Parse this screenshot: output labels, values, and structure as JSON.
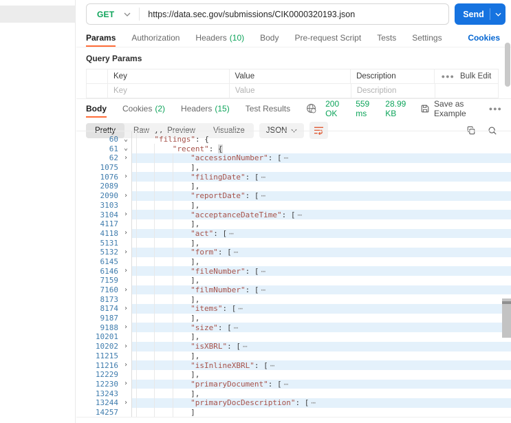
{
  "request": {
    "method": "GET",
    "url": "https://data.sec.gov/submissions/CIK0000320193.json",
    "send_label": "Send"
  },
  "request_tabs": [
    {
      "label": "Params",
      "active": true
    },
    {
      "label": "Authorization"
    },
    {
      "label": "Headers",
      "count": "(10)"
    },
    {
      "label": "Body"
    },
    {
      "label": "Pre-request Script"
    },
    {
      "label": "Tests"
    },
    {
      "label": "Settings"
    }
  ],
  "cookies_link": "Cookies",
  "query_params": {
    "title": "Query Params",
    "columns": {
      "key": "Key",
      "value": "Value",
      "description": "Description"
    },
    "bulk_edit": "Bulk Edit",
    "placeholders": {
      "key": "Key",
      "value": "Value",
      "description": "Description"
    }
  },
  "response": {
    "tabs": [
      {
        "label": "Body",
        "active": true
      },
      {
        "label": "Cookies",
        "count": "(2)"
      },
      {
        "label": "Headers",
        "count": "(15)"
      },
      {
        "label": "Test Results"
      }
    ],
    "status": "200 OK",
    "time": "559 ms",
    "size": "28.99 KB",
    "save_as_example": "Save as Example",
    "view_tabs": [
      {
        "label": "Pretty",
        "active": true
      },
      {
        "label": "Raw"
      },
      {
        "label": "Preview"
      },
      {
        "label": "Visualize"
      }
    ],
    "format": "JSON"
  },
  "colors": {
    "accent_orange": "#ff6c37",
    "method_green": "#0da45a",
    "link_blue": "#0265d2",
    "send_blue": "#1673e0",
    "key_red": "#a6524a",
    "line_number_blue": "#3f7cad",
    "fold_highlight": "#e4f1fb"
  },
  "code": {
    "fold_ellipsis": "⋯",
    "partial_top_line": "},",
    "lines": [
      {
        "num": "60",
        "chev": "down",
        "indent": 1,
        "key": "filings",
        "tail": ": {"
      },
      {
        "num": "61",
        "chev": "down",
        "indent": 2,
        "key": "recent",
        "tail": ": {",
        "brace_hl": true
      },
      {
        "num": "62",
        "chev": "right",
        "indent": 3,
        "key": "accessionNumber",
        "tail": ": [",
        "fold": true,
        "hl": true
      },
      {
        "num": "1075",
        "indent": 3,
        "plain": "],"
      },
      {
        "num": "1076",
        "chev": "right",
        "indent": 3,
        "key": "filingDate",
        "tail": ": [",
        "fold": true,
        "hl": true
      },
      {
        "num": "2089",
        "indent": 3,
        "plain": "],"
      },
      {
        "num": "2090",
        "chev": "right",
        "indent": 3,
        "key": "reportDate",
        "tail": ": [",
        "fold": true,
        "hl": true
      },
      {
        "num": "3103",
        "indent": 3,
        "plain": "],"
      },
      {
        "num": "3104",
        "chev": "right",
        "indent": 3,
        "key": "acceptanceDateTime",
        "tail": ": [",
        "fold": true,
        "hl": true
      },
      {
        "num": "4117",
        "indent": 3,
        "plain": "],"
      },
      {
        "num": "4118",
        "chev": "right",
        "indent": 3,
        "key": "act",
        "tail": ": [",
        "fold": true,
        "hl": true
      },
      {
        "num": "5131",
        "indent": 3,
        "plain": "],"
      },
      {
        "num": "5132",
        "chev": "right",
        "indent": 3,
        "key": "form",
        "tail": ": [",
        "fold": true,
        "hl": true
      },
      {
        "num": "6145",
        "indent": 3,
        "plain": "],"
      },
      {
        "num": "6146",
        "chev": "right",
        "indent": 3,
        "key": "fileNumber",
        "tail": ": [",
        "fold": true,
        "hl": true
      },
      {
        "num": "7159",
        "indent": 3,
        "plain": "],"
      },
      {
        "num": "7160",
        "chev": "right",
        "indent": 3,
        "key": "filmNumber",
        "tail": ": [",
        "fold": true,
        "hl": true
      },
      {
        "num": "8173",
        "indent": 3,
        "plain": "],"
      },
      {
        "num": "8174",
        "chev": "right",
        "indent": 3,
        "key": "items",
        "tail": ": [",
        "fold": true,
        "hl": true
      },
      {
        "num": "9187",
        "indent": 3,
        "plain": "],"
      },
      {
        "num": "9188",
        "chev": "right",
        "indent": 3,
        "key": "size",
        "tail": ": [",
        "fold": true,
        "hl": true
      },
      {
        "num": "10201",
        "indent": 3,
        "plain": "],"
      },
      {
        "num": "10202",
        "chev": "right",
        "indent": 3,
        "key": "isXBRL",
        "tail": ": [",
        "fold": true,
        "hl": true
      },
      {
        "num": "11215",
        "indent": 3,
        "plain": "],"
      },
      {
        "num": "11216",
        "chev": "right",
        "indent": 3,
        "key": "isInlineXBRL",
        "tail": ": [",
        "fold": true,
        "hl": true
      },
      {
        "num": "12229",
        "indent": 3,
        "plain": "],"
      },
      {
        "num": "12230",
        "chev": "right",
        "indent": 3,
        "key": "primaryDocument",
        "tail": ": [",
        "fold": true,
        "hl": true
      },
      {
        "num": "13243",
        "indent": 3,
        "plain": "],"
      },
      {
        "num": "13244",
        "chev": "right",
        "indent": 3,
        "key": "primaryDocDescription",
        "tail": ": [",
        "fold": true,
        "hl": true
      },
      {
        "num": "14257",
        "indent": 3,
        "plain": "]"
      }
    ]
  }
}
